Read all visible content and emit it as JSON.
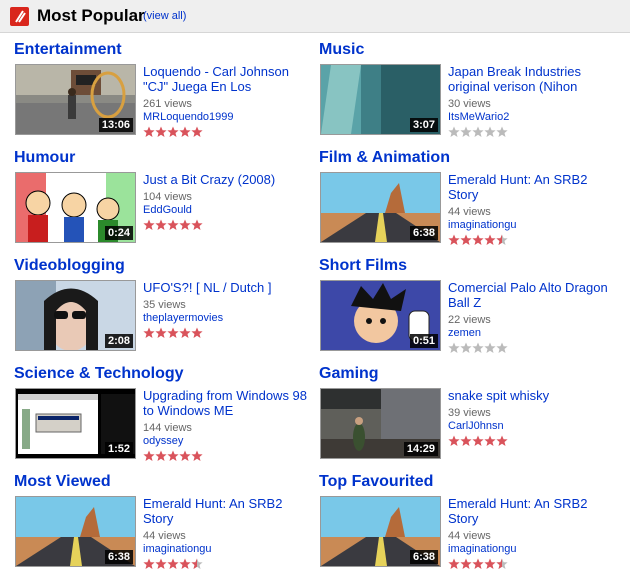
{
  "header": {
    "title": "Most Popular",
    "view_all": "(view all)"
  },
  "colors": {
    "link": "#0033cc",
    "star_on": "#d9535b",
    "star_off": "#bbbbbb",
    "logo": "#d9261c"
  },
  "categories": [
    {
      "title": "Entertainment",
      "video_title": "Loquendo - Carl Johnson \"CJ\" Juega En Los",
      "views": "261 views",
      "user": "MRLoquendo1999",
      "duration": "13:06",
      "rating": 5
    },
    {
      "title": "Music",
      "video_title": "Japan Break Industries original verison (Nihon",
      "views": "30 views",
      "user": "ItsMeWario2",
      "duration": "3:07",
      "rating": 0
    },
    {
      "title": "Humour",
      "video_title": "Just a Bit Crazy (2008)",
      "views": "104 views",
      "user": "EddGould",
      "duration": "0:24",
      "rating": 5
    },
    {
      "title": "Film & Animation",
      "video_title": "Emerald Hunt: An SRB2 Story",
      "views": "44 views",
      "user": "imaginationgu",
      "duration": "6:38",
      "rating": 4.5
    },
    {
      "title": "Videoblogging",
      "video_title": "UFO'S?! [ NL / Dutch ]",
      "views": "35 views",
      "user": "theplayermovies",
      "duration": "2:08",
      "rating": 5
    },
    {
      "title": "Short Films",
      "video_title": "Comercial Palo Alto Dragon Ball Z",
      "views": "22 views",
      "user": "zemen",
      "duration": "0:51",
      "rating": 0
    },
    {
      "title": "Science & Technology",
      "video_title": "Upgrading from Windows 98 to Windows ME",
      "views": "144 views",
      "user": "odyssey",
      "duration": "1:52",
      "rating": 5
    },
    {
      "title": "Gaming",
      "video_title": "snake spit whisky",
      "views": "39 views",
      "user": "CarlJ0hnsn",
      "duration": "14:29",
      "rating": 5
    },
    {
      "title": "Most Viewed",
      "video_title": "Emerald Hunt: An SRB2 Story",
      "views": "44 views",
      "user": "imaginationgu",
      "duration": "6:38",
      "rating": 4.5
    },
    {
      "title": "Top Favourited",
      "video_title": "Emerald Hunt: An SRB2 Story",
      "views": "44 views",
      "user": "imaginationgu",
      "duration": "6:38",
      "rating": 4.5
    }
  ]
}
